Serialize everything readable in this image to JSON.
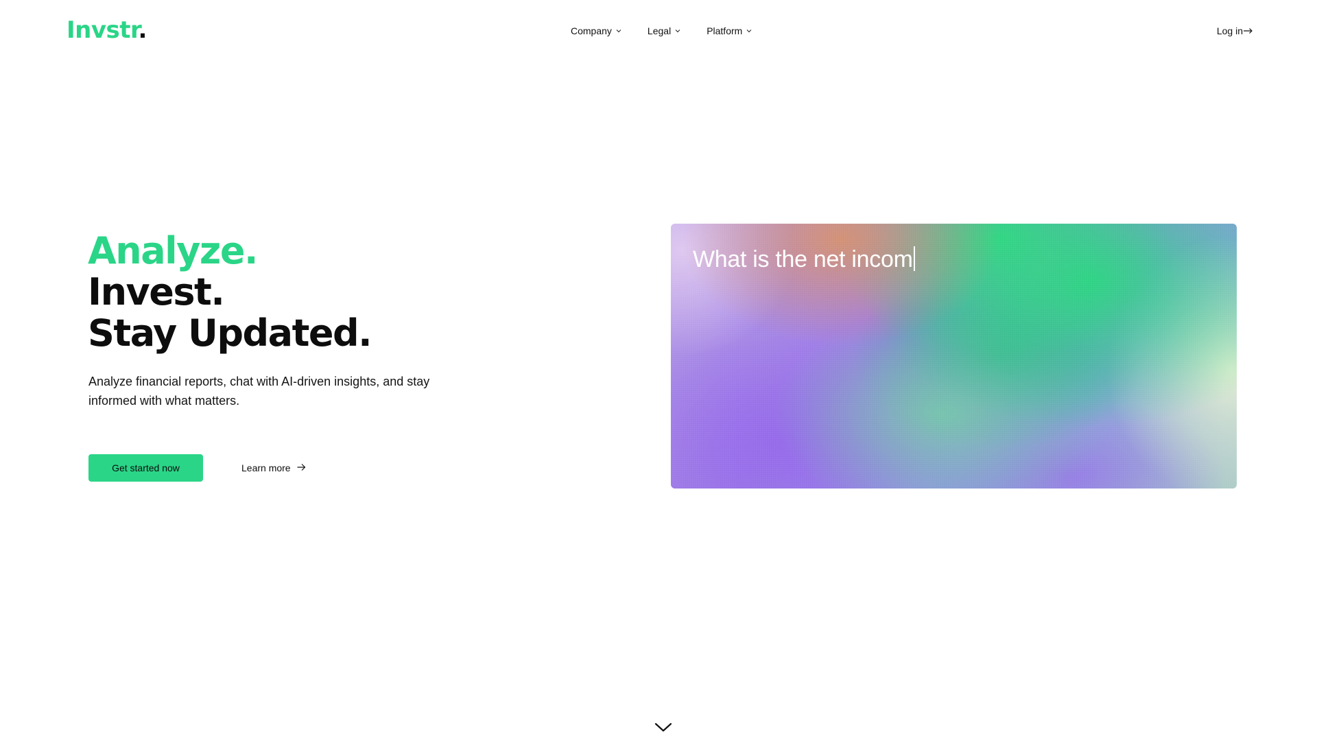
{
  "brand": {
    "logo_word": "Invstr",
    "logo_dot": ".",
    "accent_color": "#2ad587"
  },
  "nav": {
    "items": [
      {
        "label": "Company",
        "icon": "chevron-down-icon"
      },
      {
        "label": "Legal",
        "icon": "chevron-down-icon"
      },
      {
        "label": "Platform",
        "icon": "chevron-down-icon"
      }
    ],
    "login_label": "Log in",
    "login_icon": "arrow-right-icon"
  },
  "hero": {
    "title_lines": [
      "Analyze.",
      "Invest.",
      "Stay Updated."
    ],
    "subtitle": "Analyze financial reports, chat with AI-driven insights, and stay informed with what matters.",
    "cta_primary": "Get started now",
    "cta_secondary": "Learn more",
    "cta_secondary_icon": "arrow-right-icon"
  },
  "demo": {
    "typed_query": "What is the net incom"
  },
  "scroll": {
    "icon": "chevron-down-icon"
  }
}
